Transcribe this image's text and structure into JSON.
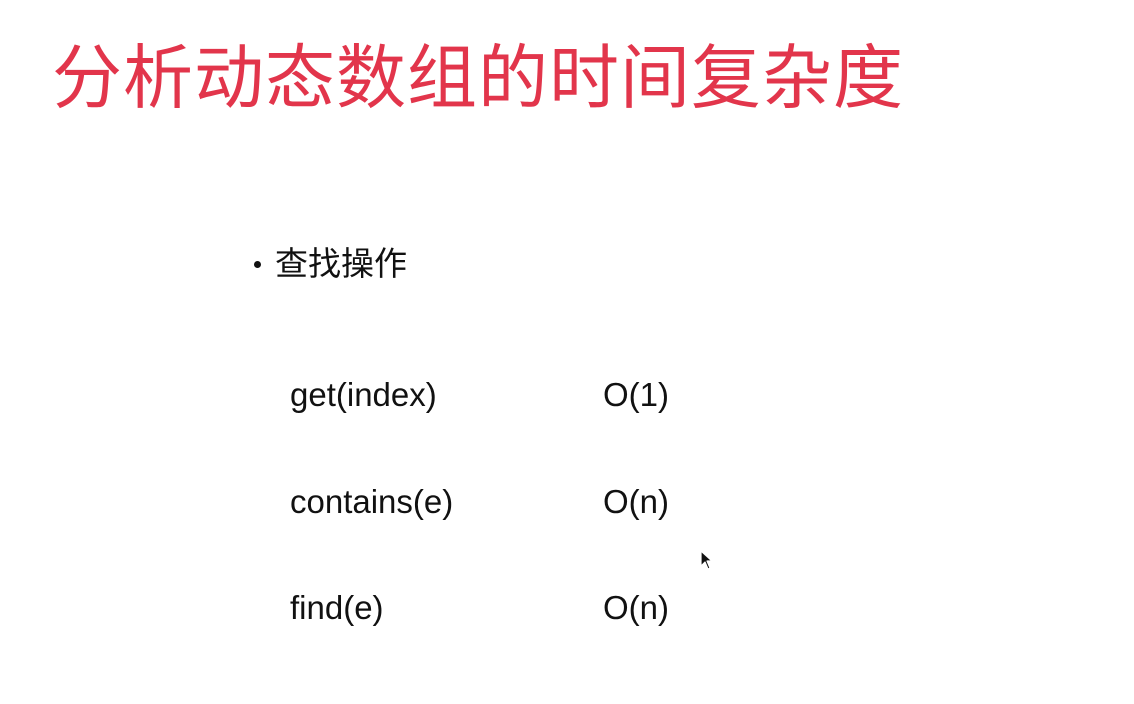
{
  "slide": {
    "title": "分析动态数组的时间复杂度",
    "bullet": "查找操作",
    "rows": [
      {
        "operation": "get(index)",
        "complexity": "O(1)"
      },
      {
        "operation": "contains(e)",
        "complexity": "O(n)"
      },
      {
        "operation": "find(e)",
        "complexity": "O(n)"
      }
    ]
  },
  "colors": {
    "title": "#e2354b",
    "text": "#111111",
    "background": "#ffffff"
  },
  "icons": {
    "cursor": "mouse-pointer-icon"
  }
}
